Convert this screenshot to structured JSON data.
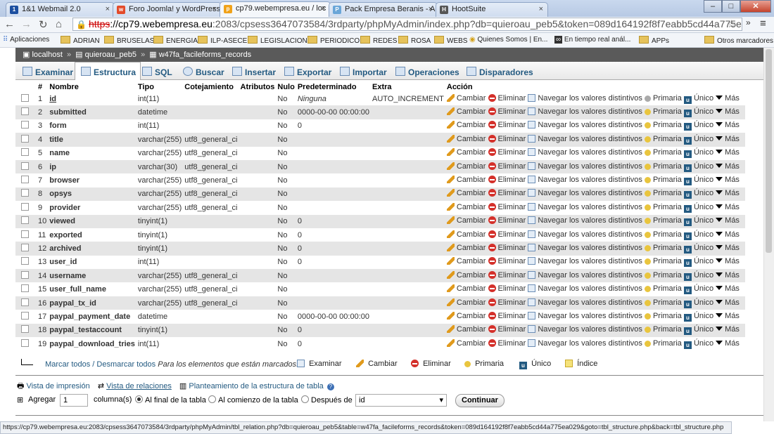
{
  "browser": {
    "tabs": [
      {
        "title": "1&1 Webmail 2.0",
        "favicon": "1&1"
      },
      {
        "title": "Foro Joomla! y WordPress",
        "favicon": "w"
      },
      {
        "title": "cp79.webempresa.eu / loc",
        "favicon": "pma"
      },
      {
        "title": "Pack Empresa Beranis - A",
        "favicon": "pack"
      },
      {
        "title": "HootSuite",
        "favicon": "hoot"
      }
    ],
    "url_scheme": "https",
    "url_host": "://cp79.webempresa.eu",
    "url_rest": ":2083/cpsess3647073584/3rdparty/phpMyAdmin/index.php?db=quieroau_peb5&token=089d164192f8f7eabb5cd44a775ea029",
    "bookmarks": [
      "Aplicaciones",
      "ADRIAN",
      "BRUSELAS",
      "ENERGIA",
      "ILP-ASECE",
      "LEGISLACION",
      "PERIODICO",
      "REDES",
      "ROSA",
      "WEBS",
      "Quienes Somos | En...",
      "En tiempo real anál...",
      "APPs",
      "Otros marcadores"
    ],
    "status_url": "https://cp79.webempresa.eu:2083/cpsess3647073584/3rdparty/phpMyAdmin/tbl_relation.php?db=quieroau_peb5&table=w47fa_facileforms_records&token=089d164192f8f7eabb5cd44a775ea029&goto=tbl_structure.php&back=tbl_structure.php"
  },
  "breadcrumb": {
    "server": "localhost",
    "db": "quieroau_peb5",
    "table": "w47fa_facileforms_records"
  },
  "menu": {
    "examinar": "Examinar",
    "estructura": "Estructura",
    "sql": "SQL",
    "buscar": "Buscar",
    "insertar": "Insertar",
    "exportar": "Exportar",
    "importar": "Importar",
    "operaciones": "Operaciones",
    "disparadores": "Disparadores"
  },
  "table": {
    "headers": {
      "num": "#",
      "name": "Nombre",
      "type": "Tipo",
      "collation": "Cotejamiento",
      "attributes": "Atributos",
      "null": "Nulo",
      "default": "Predeterminado",
      "extra": "Extra",
      "action": "Acción"
    },
    "actions": {
      "change": "Cambiar",
      "drop": "Eliminar",
      "browse": "Navegar los valores distintivos",
      "primary": "Primaria",
      "unique": "Único",
      "more": "Más"
    },
    "rows": [
      {
        "n": "1",
        "name": "id",
        "type": "int(11)",
        "collation": "",
        "null": "No",
        "default": "Ninguna",
        "extra": "AUTO_INCREMENT",
        "pk": true,
        "default_italic": true
      },
      {
        "n": "2",
        "name": "submitted",
        "type": "datetime",
        "collation": "",
        "null": "No",
        "default": "0000-00-00 00:00:00",
        "extra": ""
      },
      {
        "n": "3",
        "name": "form",
        "type": "int(11)",
        "collation": "",
        "null": "No",
        "default": "0",
        "extra": ""
      },
      {
        "n": "4",
        "name": "title",
        "type": "varchar(255)",
        "collation": "utf8_general_ci",
        "null": "No",
        "default": "",
        "extra": ""
      },
      {
        "n": "5",
        "name": "name",
        "type": "varchar(255)",
        "collation": "utf8_general_ci",
        "null": "No",
        "default": "",
        "extra": ""
      },
      {
        "n": "6",
        "name": "ip",
        "type": "varchar(30)",
        "collation": "utf8_general_ci",
        "null": "No",
        "default": "",
        "extra": ""
      },
      {
        "n": "7",
        "name": "browser",
        "type": "varchar(255)",
        "collation": "utf8_general_ci",
        "null": "No",
        "default": "",
        "extra": ""
      },
      {
        "n": "8",
        "name": "opsys",
        "type": "varchar(255)",
        "collation": "utf8_general_ci",
        "null": "No",
        "default": "",
        "extra": ""
      },
      {
        "n": "9",
        "name": "provider",
        "type": "varchar(255)",
        "collation": "utf8_general_ci",
        "null": "No",
        "default": "",
        "extra": ""
      },
      {
        "n": "10",
        "name": "viewed",
        "type": "tinyint(1)",
        "collation": "",
        "null": "No",
        "default": "0",
        "extra": ""
      },
      {
        "n": "11",
        "name": "exported",
        "type": "tinyint(1)",
        "collation": "",
        "null": "No",
        "default": "0",
        "extra": ""
      },
      {
        "n": "12",
        "name": "archived",
        "type": "tinyint(1)",
        "collation": "",
        "null": "No",
        "default": "0",
        "extra": ""
      },
      {
        "n": "13",
        "name": "user_id",
        "type": "int(11)",
        "collation": "",
        "null": "No",
        "default": "0",
        "extra": ""
      },
      {
        "n": "14",
        "name": "username",
        "type": "varchar(255)",
        "collation": "utf8_general_ci",
        "null": "No",
        "default": "",
        "extra": ""
      },
      {
        "n": "15",
        "name": "user_full_name",
        "type": "varchar(255)",
        "collation": "utf8_general_ci",
        "null": "No",
        "default": "",
        "extra": ""
      },
      {
        "n": "16",
        "name": "paypal_tx_id",
        "type": "varchar(255)",
        "collation": "utf8_general_ci",
        "null": "No",
        "default": "",
        "extra": ""
      },
      {
        "n": "17",
        "name": "paypal_payment_date",
        "type": "datetime",
        "collation": "",
        "null": "No",
        "default": "0000-00-00 00:00:00",
        "extra": ""
      },
      {
        "n": "18",
        "name": "paypal_testaccount",
        "type": "tinyint(1)",
        "collation": "",
        "null": "No",
        "default": "0",
        "extra": ""
      },
      {
        "n": "19",
        "name": "paypal_download_tries",
        "type": "int(11)",
        "collation": "",
        "null": "No",
        "default": "0",
        "extra": ""
      }
    ]
  },
  "bulk": {
    "check_all": "Marcar todos / Desmarcar todos",
    "with_selected": "Para los elementos que están marcados:",
    "browse": "Examinar",
    "change": "Cambiar",
    "drop": "Eliminar",
    "primary": "Primaria",
    "unique": "Único",
    "index": "Índice"
  },
  "links": {
    "print": "Vista de impresión",
    "relations": "Vista de relaciones",
    "propose": "Planteamiento de la estructura de tabla"
  },
  "add": {
    "label": "Agregar",
    "count": "1",
    "columns_label": "columna(s)",
    "at_end": "Al final de la tabla",
    "at_start": "Al comienzo de la tabla",
    "after": "Después de",
    "after_field": "id",
    "go": "Continuar"
  }
}
